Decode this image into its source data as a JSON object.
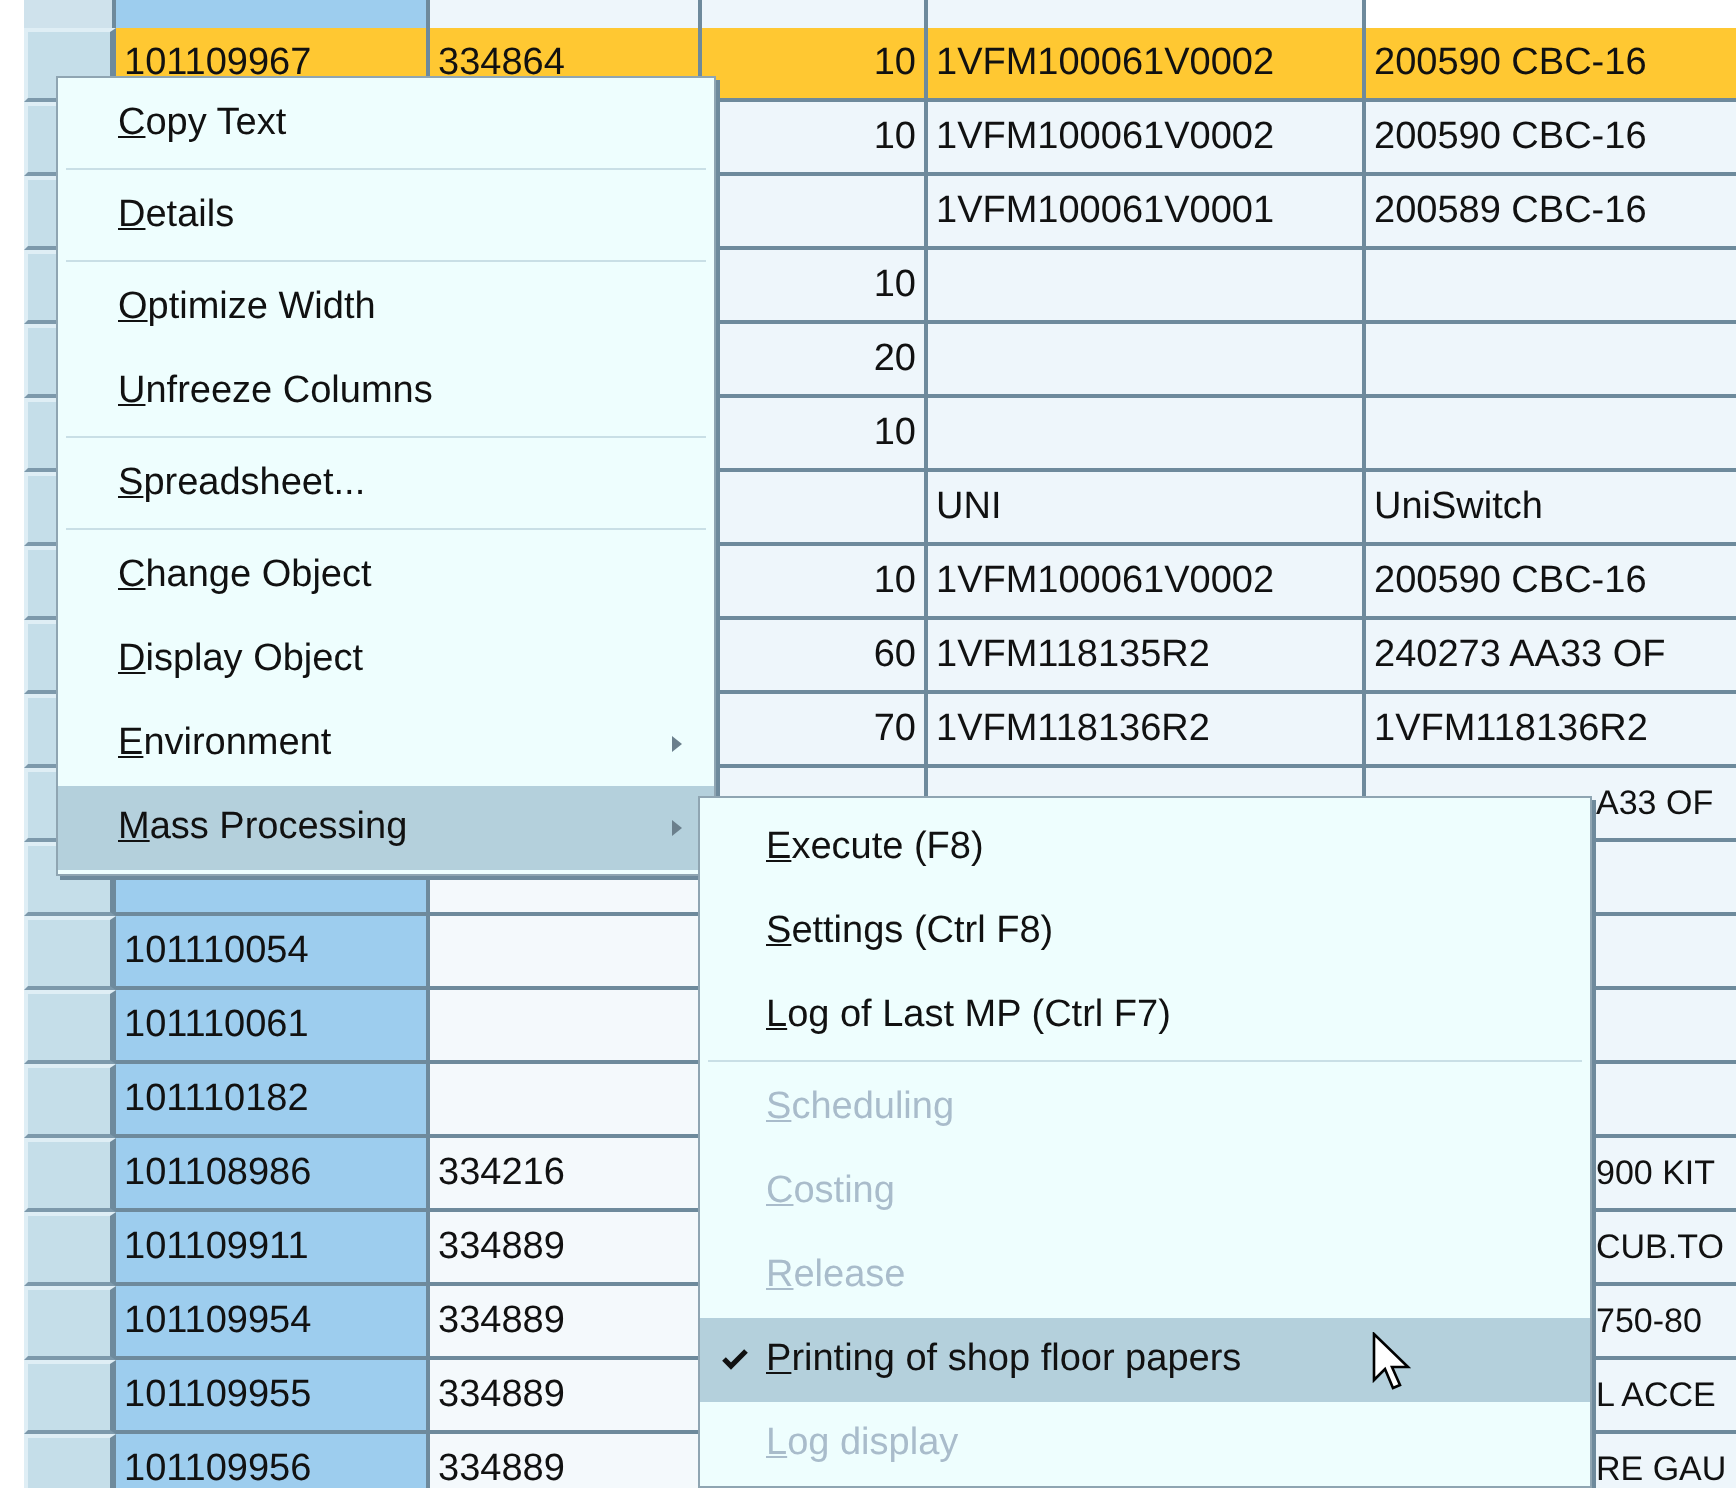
{
  "table": {
    "rows": [
      {
        "selected": true,
        "column_1": "101109967",
        "column_2": "334864",
        "column_3": "10",
        "column_4": "1VFM100061V0002",
        "column_5": "200590 CBC-16"
      },
      {
        "selected": false,
        "column_3": "10",
        "column_4": "1VFM100061V0002",
        "column_5": "200590 CBC-16"
      },
      {
        "selected": false,
        "column_4": "1VFM100061V0001",
        "column_5": "200589 CBC-16"
      },
      {
        "selected": false,
        "column_3": "10"
      },
      {
        "selected": false,
        "column_3": "20"
      },
      {
        "selected": false,
        "column_3": "10"
      },
      {
        "selected": false,
        "column_4": "UNI",
        "column_5": "UniSwitch"
      },
      {
        "selected": false,
        "column_3": "10",
        "column_4": "1VFM100061V0002",
        "column_5": "200590 CBC-16"
      },
      {
        "selected": false,
        "column_3": "60",
        "column_4": "1VFM118135R2",
        "column_5": "240273 AA33 OF"
      },
      {
        "selected": false,
        "column_3": "70",
        "column_4": "1VFM118136R2",
        "column_5": "1VFM118136R2"
      },
      {
        "selected": false,
        "column_5": "A33 OF",
        "column_5_cut": true
      },
      {
        "selected": false
      },
      {
        "selected": false,
        "column_1": "101110054"
      },
      {
        "selected": false,
        "column_1": "101110061"
      },
      {
        "selected": false,
        "column_1": "101110182"
      },
      {
        "selected": false,
        "column_1": "101108986",
        "column_2": "334216",
        "column_5": "900 KIT",
        "column_5_cut": true
      },
      {
        "selected": false,
        "column_1": "101109911",
        "column_2": "334889",
        "column_5": "CUB.TO",
        "column_5_cut": true
      },
      {
        "selected": false,
        "column_1": "101109954",
        "column_2": "334889",
        "column_5": "750-80",
        "column_5_cut": true
      },
      {
        "selected": false,
        "column_1": "101109955",
        "column_2": "334889",
        "column_5": "L ACCE",
        "column_5_cut": true
      },
      {
        "selected": false,
        "column_1": "101109956",
        "column_2": "334889",
        "column_5": "RE GAU",
        "column_5_cut": true
      }
    ]
  },
  "context_menu": {
    "groups": [
      [
        {
          "label": "Copy Text",
          "submenu": false,
          "selected": false
        }
      ],
      [
        {
          "label": "Details",
          "submenu": false,
          "selected": false
        }
      ],
      [
        {
          "label": "Optimize Width",
          "submenu": false,
          "selected": false
        },
        {
          "label": "Unfreeze Columns",
          "submenu": false,
          "selected": false
        }
      ],
      [
        {
          "label": "Spreadsheet...",
          "submenu": false,
          "selected": false
        }
      ],
      [
        {
          "label": "Change Object",
          "submenu": false,
          "selected": false
        },
        {
          "label": "Display Object",
          "submenu": false,
          "selected": false
        },
        {
          "label": "Environment",
          "submenu": true,
          "selected": false
        },
        {
          "label": "Mass Processing",
          "submenu": true,
          "selected": true
        }
      ]
    ]
  },
  "submenu": {
    "groups": [
      [
        {
          "label": "Execute (F8)",
          "disabled": false,
          "checked": false,
          "selected": false
        },
        {
          "label": "Settings (Ctrl F8)",
          "disabled": false,
          "checked": false,
          "selected": false
        },
        {
          "label": "Log of Last MP (Ctrl F7)",
          "disabled": false,
          "checked": false,
          "selected": false
        }
      ],
      [
        {
          "label": "Scheduling",
          "disabled": true,
          "checked": false,
          "selected": false
        },
        {
          "label": "Costing",
          "disabled": true,
          "checked": false,
          "selected": false
        },
        {
          "label": "Release",
          "disabled": true,
          "checked": false,
          "selected": false
        },
        {
          "label": "Printing of shop floor papers",
          "disabled": false,
          "checked": true,
          "selected": true
        },
        {
          "label": "Log display",
          "disabled": true,
          "checked": false,
          "selected": false
        }
      ]
    ]
  }
}
